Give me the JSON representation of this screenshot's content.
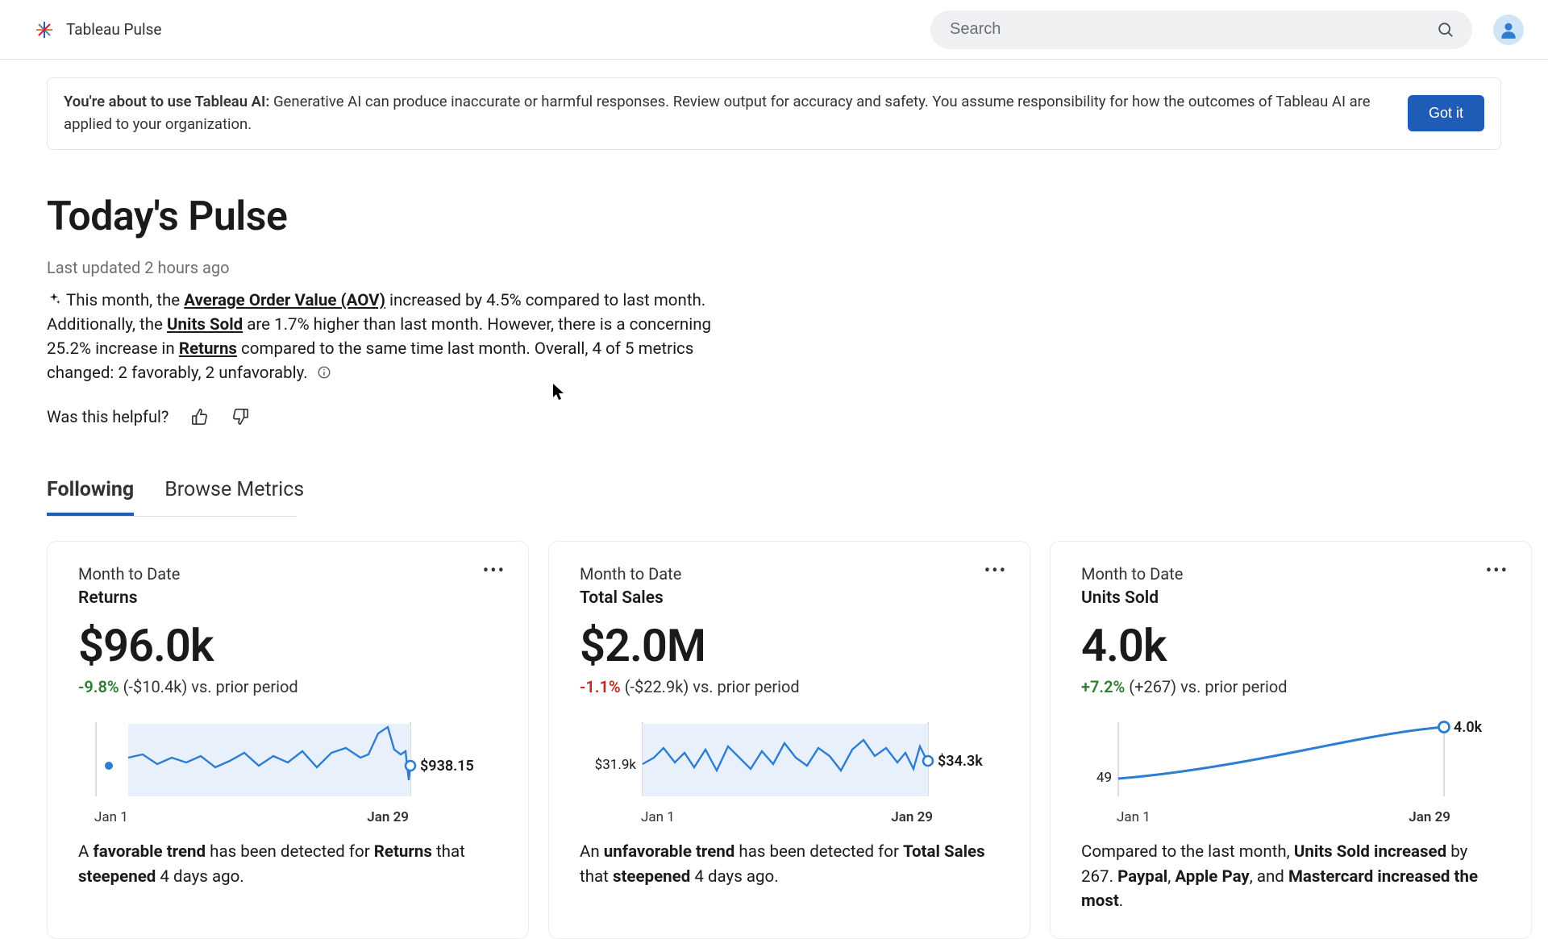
{
  "header": {
    "product": "Tableau Pulse",
    "search_placeholder": "Search"
  },
  "notice": {
    "bold": "You're about to use Tableau AI:",
    "rest": " Generative AI can produce inaccurate or harmful responses. Review output for accuracy and safety. You assume responsibility for how the outcomes of Tableau AI are applied to your organization.",
    "button": "Got it"
  },
  "page": {
    "title": "Today's Pulse",
    "updated": "Last updated 2 hours ago",
    "summary": {
      "p1a": "This month, the ",
      "link1": "Average Order Value (AOV)",
      "p1b": " increased by 4.5% compared to last month. Additionally, the ",
      "link2": "Units Sold",
      "p1c": " are 1.7% higher than last month. However, there is a concerning 25.2% increase in ",
      "link3": "Returns",
      "p1d": " compared to the same time last month. Overall, 4 of 5 metrics changed: 2 favorably, 2 unfavorably."
    },
    "feedback_label": "Was this helpful?"
  },
  "tabs": {
    "following": "Following",
    "browse": "Browse Metrics"
  },
  "cards": [
    {
      "period": "Month to Date",
      "title": "Returns",
      "value": "$96.0k",
      "delta_pct": "-9.8%",
      "delta_sign": "neg-good",
      "delta_rest": " (-$10.4k) vs. prior period",
      "end_label": "$938.15",
      "axis_start": "Jan 1",
      "axis_end": "Jan 29",
      "insight": {
        "a": "A ",
        "b1": "favorable trend",
        "c": " has been detected for ",
        "b2": "Returns",
        "d": " that ",
        "b3": "steepened",
        "e": " 4 days ago."
      }
    },
    {
      "period": "Month to Date",
      "title": "Total Sales",
      "value": "$2.0M",
      "delta_pct": "-1.1%",
      "delta_sign": "neg",
      "delta_rest": " (-$22.9k) vs. prior period",
      "start_label": "$31.9k",
      "end_label": "$34.3k",
      "axis_start": "Jan 1",
      "axis_end": "Jan 29",
      "insight": {
        "a": "An ",
        "b1": "unfavorable trend",
        "c": " has been detected for ",
        "b2": "Total Sales",
        "d": " that ",
        "b3": "steepened",
        "e": " 4 days ago."
      }
    },
    {
      "period": "Month to Date",
      "title": "Units Sold",
      "value": "4.0k",
      "delta_pct": "+7.2%",
      "delta_sign": "pos",
      "delta_rest": " (+267) vs. prior period",
      "start_label": "49",
      "end_label": "4.0k",
      "axis_start": "Jan 1",
      "axis_end": "Jan 29",
      "insight": {
        "a": "Compared to the last month, ",
        "b1": "Units Sold increased",
        "c": " by 267. ",
        "b2": "Paypal",
        "d": ", ",
        "b3": "Apple Pay",
        "e": ", and ",
        "b4": "Mastercard increased the most",
        "f": "."
      }
    }
  ],
  "chart_data": [
    {
      "type": "line",
      "title": "Returns — Month to Date",
      "x_range": [
        "Jan 1",
        "Jan 29"
      ],
      "end_value": 938.15,
      "values": [
        2800,
        2850,
        2500,
        2950,
        2600,
        2900,
        2400,
        2750,
        3000,
        2500,
        2900,
        2600,
        3050,
        2400,
        3000,
        3200,
        2700,
        2850,
        3600,
        3900,
        3000,
        2700,
        2850,
        1800,
        938.15
      ],
      "ylabel": "Returns ($)"
    },
    {
      "type": "line",
      "title": "Total Sales — Month to Date",
      "x_range": [
        "Jan 1",
        "Jan 29"
      ],
      "start_value": 31900,
      "end_value": 34300,
      "values": [
        31900,
        33000,
        35000,
        32000,
        34200,
        31000,
        34800,
        30500,
        35200,
        33000,
        30800,
        34500,
        31500,
        35800,
        32500,
        31000,
        35000,
        33500,
        30500,
        34800,
        36500,
        33200,
        35000,
        31800,
        33800,
        30200,
        35200,
        33500,
        34300
      ],
      "ylabel": "Total Sales ($)"
    },
    {
      "type": "line",
      "title": "Units Sold — Cumulative Month to Date",
      "x_range": [
        "Jan 1",
        "Jan 29"
      ],
      "start_value": 49,
      "end_value": 4000,
      "values": [
        49,
        190,
        340,
        490,
        650,
        820,
        1000,
        1190,
        1390,
        1600,
        1820,
        2050,
        2280,
        2490,
        2690,
        2880,
        3060,
        3230,
        3390,
        3540,
        3680,
        3800,
        3910,
        3990,
        4060,
        4090,
        4080,
        4050,
        4000
      ],
      "ylabel": "Units Sold"
    }
  ]
}
